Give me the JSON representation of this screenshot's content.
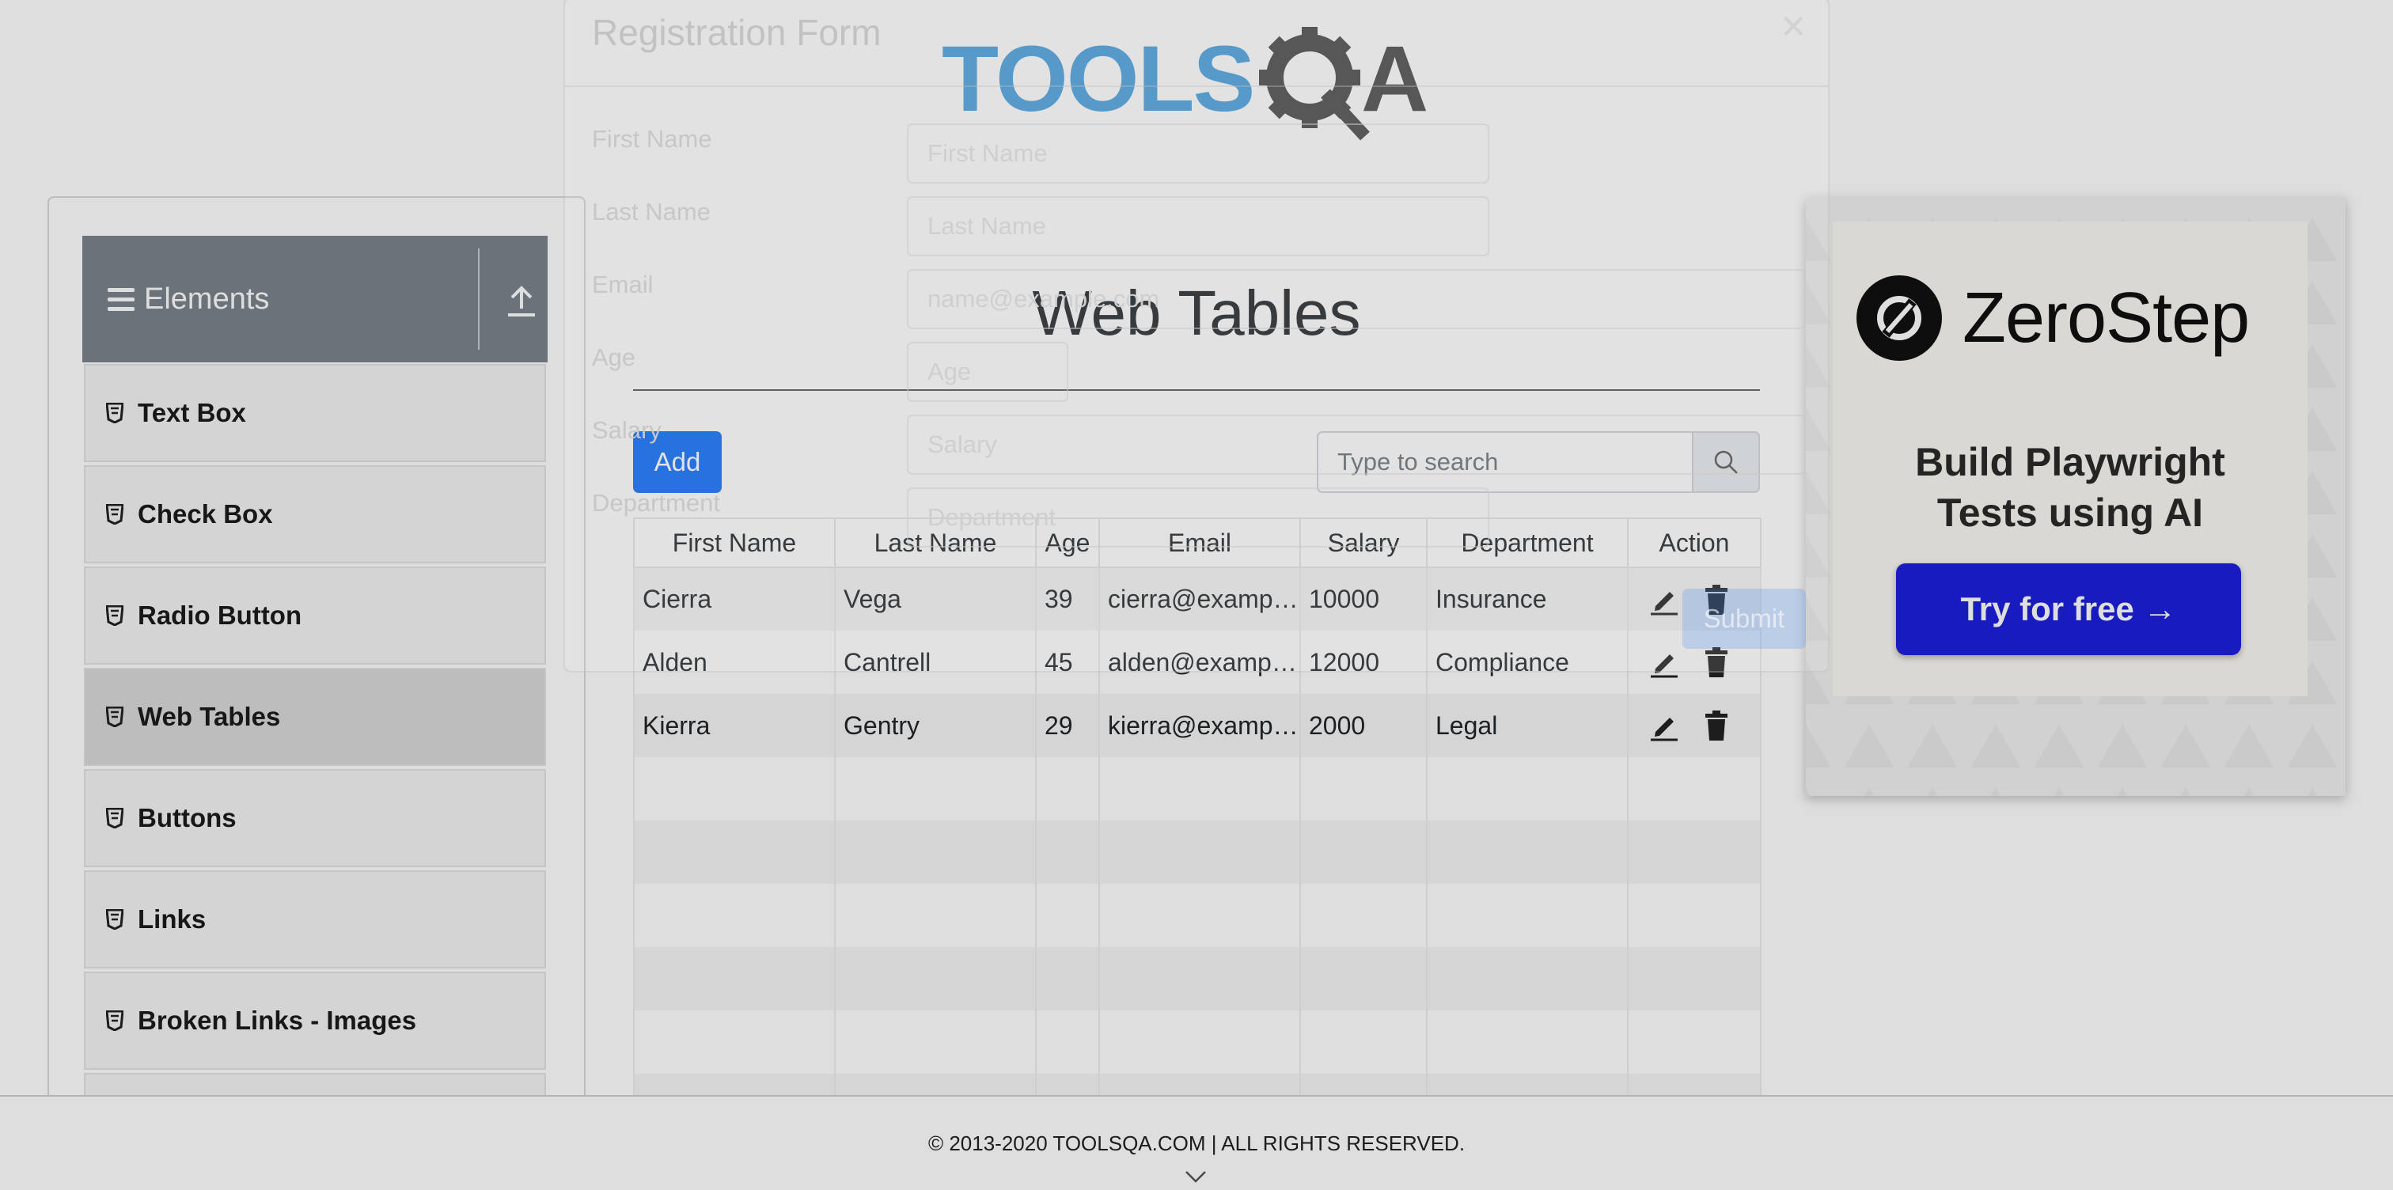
{
  "brand": {
    "logo_text": "TOOLSQA",
    "logo_color": "#4aa3df",
    "gear_color": "#4a4a4a"
  },
  "sidebar": {
    "group_title": "Elements",
    "items": [
      {
        "label": "Text Box"
      },
      {
        "label": "Check Box"
      },
      {
        "label": "Radio Button"
      },
      {
        "label": "Web Tables",
        "active": true
      },
      {
        "label": "Buttons"
      },
      {
        "label": "Links"
      },
      {
        "label": "Broken Links - Images"
      }
    ]
  },
  "main": {
    "heading": "Web Tables",
    "add_label": "Add",
    "search_placeholder": "Type to search",
    "table": {
      "headers": [
        "First Name",
        "Last Name",
        "Age",
        "Email",
        "Salary",
        "Department",
        "Action"
      ],
      "rows": [
        {
          "first": "Cierra",
          "last": "Vega",
          "age": "39",
          "email": "cierra@example.com",
          "salary": "10000",
          "department": "Insurance"
        },
        {
          "first": "Alden",
          "last": "Cantrell",
          "age": "45",
          "email": "alden@example.com",
          "salary": "12000",
          "department": "Compliance"
        },
        {
          "first": "Kierra",
          "last": "Gentry",
          "age": "29",
          "email": "kierra@example.com",
          "salary": "2000",
          "department": "Legal"
        }
      ]
    }
  },
  "ad": {
    "brand": "ZeroStep",
    "tagline_line1": "Build Playwright",
    "tagline_line2": "Tests using AI",
    "cta": "Try for free →",
    "cta_color": "#1b1fdd"
  },
  "footer": {
    "copyright": "© 2013-2020 TOOLSQA.COM | ALL RIGHTS RESERVED."
  },
  "modal": {
    "title": "Registration Form",
    "close": "×",
    "fields": [
      {
        "label": "First Name",
        "placeholder": "First Name"
      },
      {
        "label": "Last Name",
        "placeholder": "Last Name"
      },
      {
        "label": "Email",
        "placeholder": "name@example.com"
      },
      {
        "label": "Age",
        "placeholder": "Age"
      },
      {
        "label": "Salary",
        "placeholder": "Salary"
      },
      {
        "label": "Department",
        "placeholder": "Department"
      }
    ],
    "submit": "Submit"
  }
}
